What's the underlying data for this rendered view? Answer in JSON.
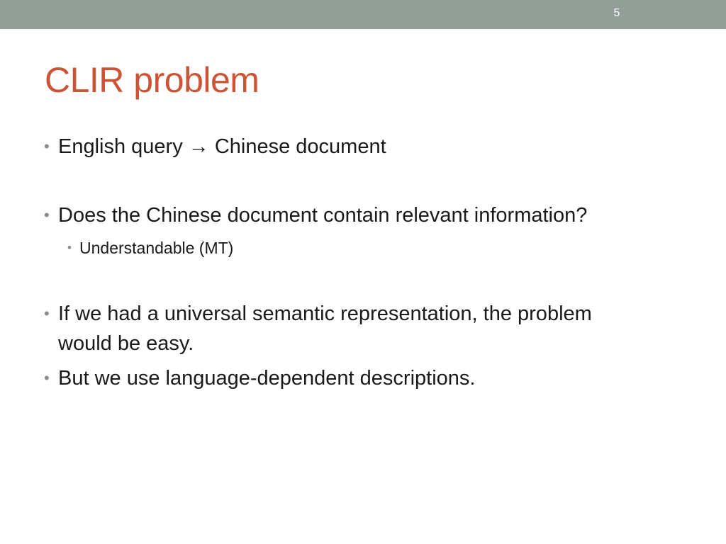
{
  "slide": {
    "number": "5",
    "title": "CLIR problem",
    "bullet_glyph": "•",
    "bullets": [
      {
        "before_arrow": "English query ",
        "arrow": "→",
        "after_arrow": " Chinese document"
      },
      {
        "text": "Does the Chinese document contain relevant information?"
      },
      {
        "text": "Understandable (MT)"
      },
      {
        "text": "If we had a universal semantic representation, the problem would be easy."
      },
      {
        "text": "But we use language-dependent descriptions."
      }
    ]
  },
  "colors": {
    "top_bar": "#949e98",
    "title": "#cc5436",
    "body_text": "#1a1a1a",
    "bullet_dot": "#8a8a8a"
  }
}
